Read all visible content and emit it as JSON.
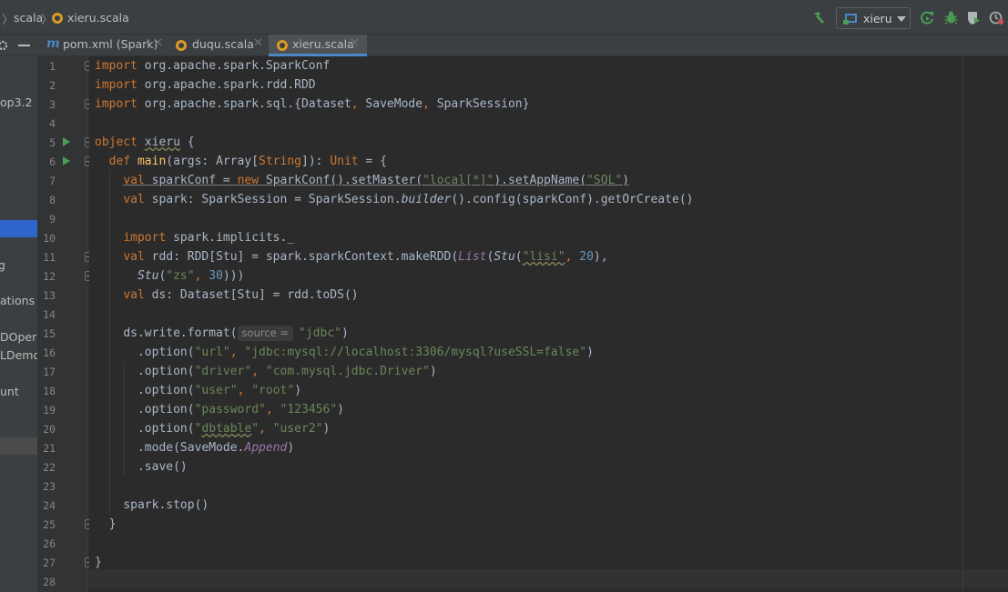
{
  "breadcrumb": {
    "folder": "scala",
    "file": "xieru.scala"
  },
  "toolbar": {
    "run_config": "xieru"
  },
  "tabs": [
    {
      "label": "pom.xml (Spark)",
      "icon": "maven-icon"
    },
    {
      "label": "duqu.scala",
      "icon": "scala-file-icon"
    },
    {
      "label": "xieru.scala",
      "icon": "scala-file-icon",
      "active": true
    }
  ],
  "project_panel": {
    "items": [
      "op3.2",
      "g",
      "ations",
      "DOpera",
      "LDemo",
      "unt"
    ]
  },
  "editor": {
    "line_numbers": [
      "1",
      "2",
      "3",
      "4",
      "5",
      "6",
      "7",
      "8",
      "9",
      "10",
      "11",
      "12",
      "13",
      "14",
      "15",
      "16",
      "17",
      "18",
      "19",
      "20",
      "21",
      "22",
      "23",
      "24",
      "25",
      "26",
      "27",
      "28"
    ],
    "lines": {
      "l1": {
        "kw": "import",
        "rest": " org.apache.spark.SparkConf"
      },
      "l2": {
        "kw": "import",
        "rest": " org.apache.spark.rdd.RDD"
      },
      "l3": {
        "kw": "import",
        "a": " org.apache.spark.sql.{Dataset",
        "c1": ",",
        "b": " SaveMode",
        "c2": ",",
        "c": " SparkSession}"
      },
      "l5": {
        "kw": "object",
        "sp": " ",
        "name": "xieru",
        "rest": " {"
      },
      "l6": {
        "kw": "def",
        "sp": " ",
        "name": "main",
        "a": "(args: Array[",
        "t": "String",
        "b": "]): ",
        "u": "Unit",
        "c": " = {"
      },
      "l7": {
        "kw1": "val",
        "sp1": " ",
        "v": "sparkConf",
        "eq": " = ",
        "kw2": "new",
        "sp2": " ",
        "a": "SparkConf().setMaster(",
        "s1": "\"local[*]\"",
        "b": ").setAppName(",
        "s2": "\"SQL\"",
        "c": ")"
      },
      "l8": {
        "kw": "val",
        "a": " spark: SparkSession = SparkSession.",
        "m": "builder",
        "b": "().config(sparkConf).getOrCreate()"
      },
      "l10": {
        "kw": "import",
        "rest": " spark.implicits._"
      },
      "l11": {
        "kw": "val",
        "a": " rdd: RDD[Stu] = spark.sparkContext.makeRDD(",
        "list": "List",
        "b": "(",
        "stu": "Stu",
        "c": "(",
        "s": "\"lisi\"",
        "d": ", ",
        "n": "20",
        "e": "),"
      },
      "l12": {
        "stu": "Stu",
        "a": "(",
        "s": "\"zs\"",
        "b": ", ",
        "n": "30",
        "c": ")))"
      },
      "l13": {
        "kw": "val",
        "rest": " ds: Dataset[Stu] = rdd.toDS()"
      },
      "l15": {
        "a": "ds.write.format(",
        "hint": "source =",
        "s": "\"jdbc\"",
        "b": ")"
      },
      "l16": {
        "a": ".option(",
        "s1": "\"url\"",
        "c": ", ",
        "s2": "\"jdbc:mysql://localhost:3306/mysql?useSSL=false\"",
        "b": ")"
      },
      "l17": {
        "a": ".option(",
        "s1": "\"driver\"",
        "c": ", ",
        "s2": "\"com.mysql.jdbc.Driver\"",
        "b": ")"
      },
      "l18": {
        "a": ".option(",
        "s1": "\"user\"",
        "c": ", ",
        "s2": "\"root\"",
        "b": ")"
      },
      "l19": {
        "a": ".option(",
        "s1": "\"password\"",
        "c": ", ",
        "s2": "\"123456\"",
        "b": ")"
      },
      "l20": {
        "a": ".option(",
        "q1": "\"",
        "w": "dbtable",
        "q2": "\"",
        "c": ", ",
        "s2": "\"user2\"",
        "b": ")"
      },
      "l21": {
        "a": ".mode(SaveMode.",
        "p": "Append",
        "b": ")"
      },
      "l22": {
        "rest": ".save()"
      },
      "l24": {
        "rest": "spark.stop()"
      },
      "l25": {
        "rest": "}"
      },
      "l27": {
        "rest": "}"
      }
    }
  },
  "colors": {
    "keyword": "#cc7832",
    "string": "#6a8759",
    "number": "#6897bb",
    "plain": "#a9b7c6",
    "purple": "#9876aa",
    "tab_accent": "#4a88c7",
    "run_green": "#499c54",
    "scala_orange": "#d99a26"
  }
}
